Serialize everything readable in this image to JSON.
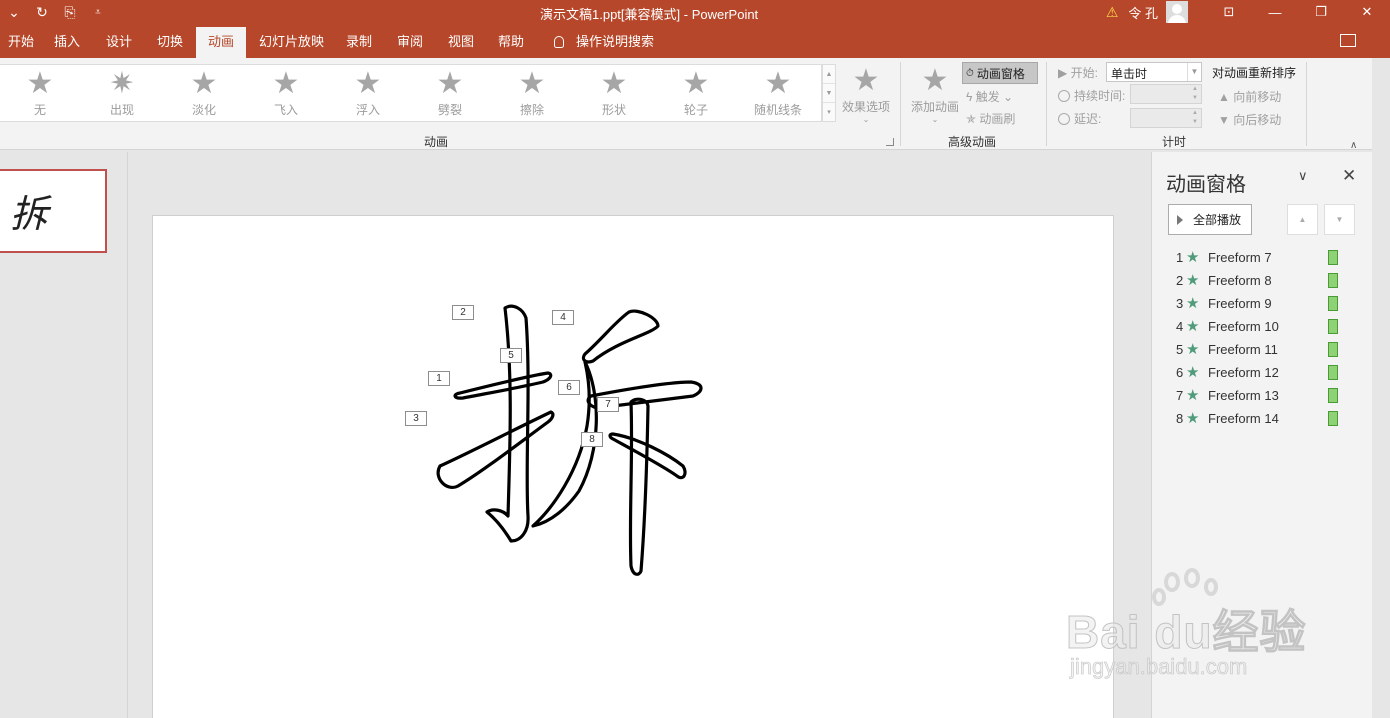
{
  "titlebar": {
    "qat_items": [
      "⌄",
      "↻",
      "⎘",
      "⩡"
    ],
    "doc_title": "演示文稿1.ppt[兼容模式]  -  PowerPoint",
    "user_name": "令 孔",
    "warn_icon": "⚠",
    "window_buttons": {
      "restore_ribbon": "⊡",
      "minimize": "—",
      "maximize": "❐",
      "close": "✕"
    }
  },
  "tabs": [
    {
      "label": "开始"
    },
    {
      "label": "插入"
    },
    {
      "label": "设计"
    },
    {
      "label": "切换"
    },
    {
      "label": "动画",
      "active": true
    },
    {
      "label": "幻灯片放映"
    },
    {
      "label": "录制"
    },
    {
      "label": "审阅"
    },
    {
      "label": "视图"
    },
    {
      "label": "帮助"
    },
    {
      "label": "操作说明搜索"
    }
  ],
  "ribbon": {
    "animations": [
      {
        "label": "无"
      },
      {
        "label": "出现"
      },
      {
        "label": "淡化"
      },
      {
        "label": "飞入"
      },
      {
        "label": "浮入"
      },
      {
        "label": "劈裂"
      },
      {
        "label": "擦除"
      },
      {
        "label": "形状"
      },
      {
        "label": "轮子"
      },
      {
        "label": "随机线条"
      }
    ],
    "effect_options": "效果选项",
    "group_animation": "动画",
    "add_animation": "添加动画",
    "animation_pane_btn": "动画窗格",
    "trigger": "触发",
    "animation_painter": "动画刷",
    "group_advanced": "高级动画",
    "start_label": "开始:",
    "start_value": "单击时",
    "duration_label": "持续时间:",
    "delay_label": "延迟:",
    "group_timing": "计时",
    "reorder_title": "对动画重新排序",
    "move_earlier": "向前移动",
    "move_later": "向后移动"
  },
  "thumbnail": {
    "char": "拆"
  },
  "slide_tags": [
    "1",
    "2",
    "3",
    "4",
    "5",
    "6",
    "7",
    "8"
  ],
  "pane": {
    "title": "动画窗格",
    "play_all": "全部播放",
    "items": [
      {
        "num": "1",
        "name": "Freeform 7"
      },
      {
        "num": "2",
        "name": "Freeform 8"
      },
      {
        "num": "3",
        "name": "Freeform 9"
      },
      {
        "num": "4",
        "name": "Freeform 10"
      },
      {
        "num": "5",
        "name": "Freeform 11"
      },
      {
        "num": "6",
        "name": "Freeform 12"
      },
      {
        "num": "7",
        "name": "Freeform 13"
      },
      {
        "num": "8",
        "name": "Freeform 14"
      }
    ]
  },
  "watermark": {
    "main": "Bai du经验",
    "url": "jingyan.baidu.com"
  },
  "colors": {
    "accent": "#b7472a",
    "ribbon_bg": "#f3f3f3",
    "star_green": "#4f9b7a",
    "bar_green": "#8fd175"
  }
}
